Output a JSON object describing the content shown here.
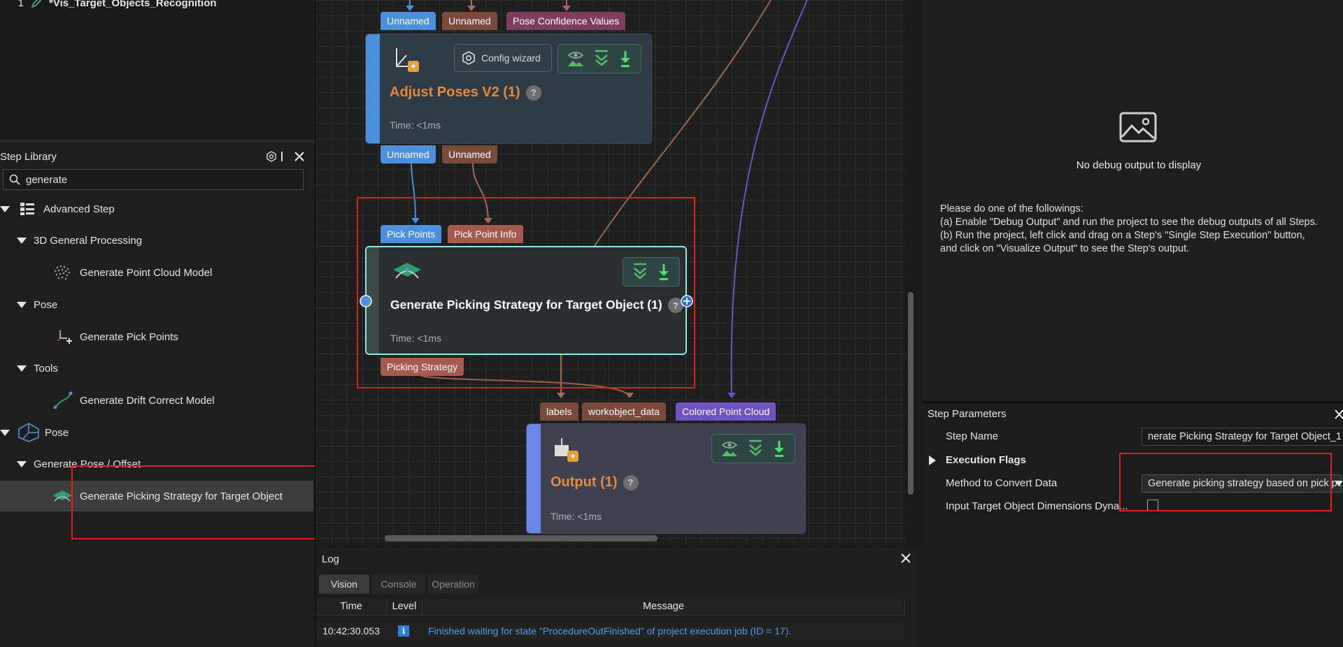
{
  "project_list": {
    "row_number": "1",
    "project_name": "*Vis_Target_Objects_Recognition"
  },
  "step_library": {
    "title": "Step Library",
    "search": {
      "value": "generate",
      "placeholder": ""
    },
    "tree": [
      {
        "label": "Advanced Step",
        "icon": "advanced-step-icon"
      },
      {
        "label": "3D General Processing"
      },
      {
        "label": "Generate Point Cloud Model",
        "icon": "point-cloud-icon"
      },
      {
        "label": "Pose"
      },
      {
        "label": "Generate Pick Points",
        "icon": "pick-points-icon"
      },
      {
        "label": "Tools"
      },
      {
        "label": "Generate Drift Correct Model",
        "icon": "drift-correct-icon"
      },
      {
        "label": "Pose",
        "icon": "pose-icon"
      },
      {
        "label": "Generate Pose / Offset"
      },
      {
        "label": "Generate Picking Strategy for Target Object",
        "icon": "picking-strategy-icon"
      }
    ]
  },
  "canvas": {
    "node1": {
      "inputs": [
        "Unnamed",
        "Unnamed",
        "Pose Confidence Values"
      ],
      "config_wizard": "Config wizard",
      "title": "Adjust Poses V2 (1)",
      "time": "Time: <1ms",
      "outputs": [
        "Unnamed",
        "Unnamed"
      ]
    },
    "node2": {
      "inputs": [
        "Pick Points",
        "Pick Point Info"
      ],
      "title": "Generate Picking Strategy for Target Object (1)",
      "time": "Time: <1ms",
      "outputs": [
        "Picking Strategy"
      ]
    },
    "node3": {
      "inputs": [
        "labels",
        "workobject_data",
        "Colored Point Cloud"
      ],
      "title": "Output (1)",
      "time": "Time: <1ms"
    },
    "help_symbol": "?"
  },
  "debug": {
    "empty_message": "No debug output to display",
    "instructions": [
      "Please do one of the followings:",
      "(a) Enable \"Debug Output\" and run the project to see the debug outputs of all Steps.",
      "(b) Run the project, left click and drag on a Step's \"Single Step Execution\" button,",
      "and click on \"Visualize Output\" to see the Step's output."
    ]
  },
  "step_parameters": {
    "title": "Step Parameters",
    "rows": [
      {
        "label": "Step Name",
        "value": "nerate Picking Strategy for Target Object_1"
      },
      {
        "label": "Execution Flags"
      },
      {
        "label": "Method to Convert Data",
        "value": "Generate picking strategy based on pick points"
      },
      {
        "label": "Input Target Object Dimensions Dyna..."
      }
    ]
  },
  "log": {
    "title": "Log",
    "tabs": [
      "Vision",
      "Console",
      "Operation"
    ],
    "columns": [
      "Time",
      "Level",
      "Message"
    ],
    "entries": [
      {
        "time": "10:42:30.053",
        "level": "info",
        "message": "Finished waiting for state \"ProcedureOutFinished\" of project execution job (ID = 17)."
      }
    ]
  },
  "colors": {
    "port_blue": "#4c8fdc",
    "port_brown": "#7a4a3c",
    "port_pink": "#7d3e5e",
    "port_red": "#a5594f",
    "port_purple": "#6f52c4",
    "node_title_orange": "#e58a3c",
    "highlight_red": "#e02020"
  }
}
